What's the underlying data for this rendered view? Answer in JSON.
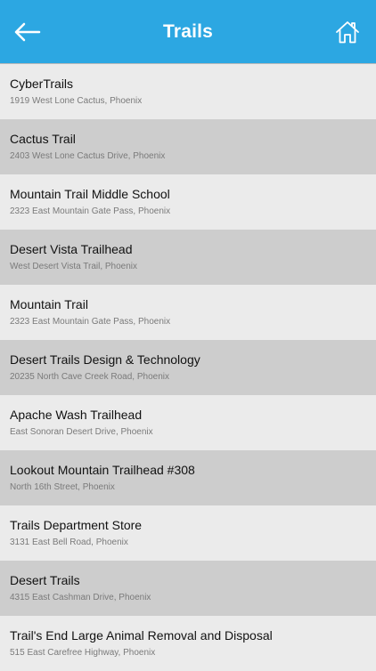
{
  "header": {
    "title": "Trails"
  },
  "colors": {
    "header_bg": "#2ca7e2",
    "row_light": "#ebebeb",
    "row_dark": "#cdcdcd"
  },
  "icons": {
    "back": "back-arrow-icon",
    "home": "home-icon"
  },
  "trails": [
    {
      "name": "CyberTrails",
      "address": "1919 West Lone Cactus, Phoenix"
    },
    {
      "name": "Cactus Trail",
      "address": "2403 West Lone Cactus Drive, Phoenix"
    },
    {
      "name": "Mountain Trail Middle School",
      "address": "2323 East Mountain Gate Pass, Phoenix"
    },
    {
      "name": "Desert Vista Trailhead",
      "address": "West Desert Vista Trail, Phoenix"
    },
    {
      "name": "Mountain Trail",
      "address": "2323 East Mountain Gate Pass, Phoenix"
    },
    {
      "name": "Desert Trails Design & Technology",
      "address": "20235 North Cave Creek Road, Phoenix"
    },
    {
      "name": "Apache Wash Trailhead",
      "address": "East Sonoran Desert Drive, Phoenix"
    },
    {
      "name": "Lookout Mountain Trailhead #308",
      "address": "North 16th Street, Phoenix"
    },
    {
      "name": "Trails Department Store",
      "address": "3131 East Bell Road, Phoenix"
    },
    {
      "name": "Desert Trails",
      "address": "4315 East Cashman Drive, Phoenix"
    },
    {
      "name": "Trail's End Large Animal Removal and Disposal",
      "address": "515 East Carefree Highway, Phoenix"
    }
  ]
}
